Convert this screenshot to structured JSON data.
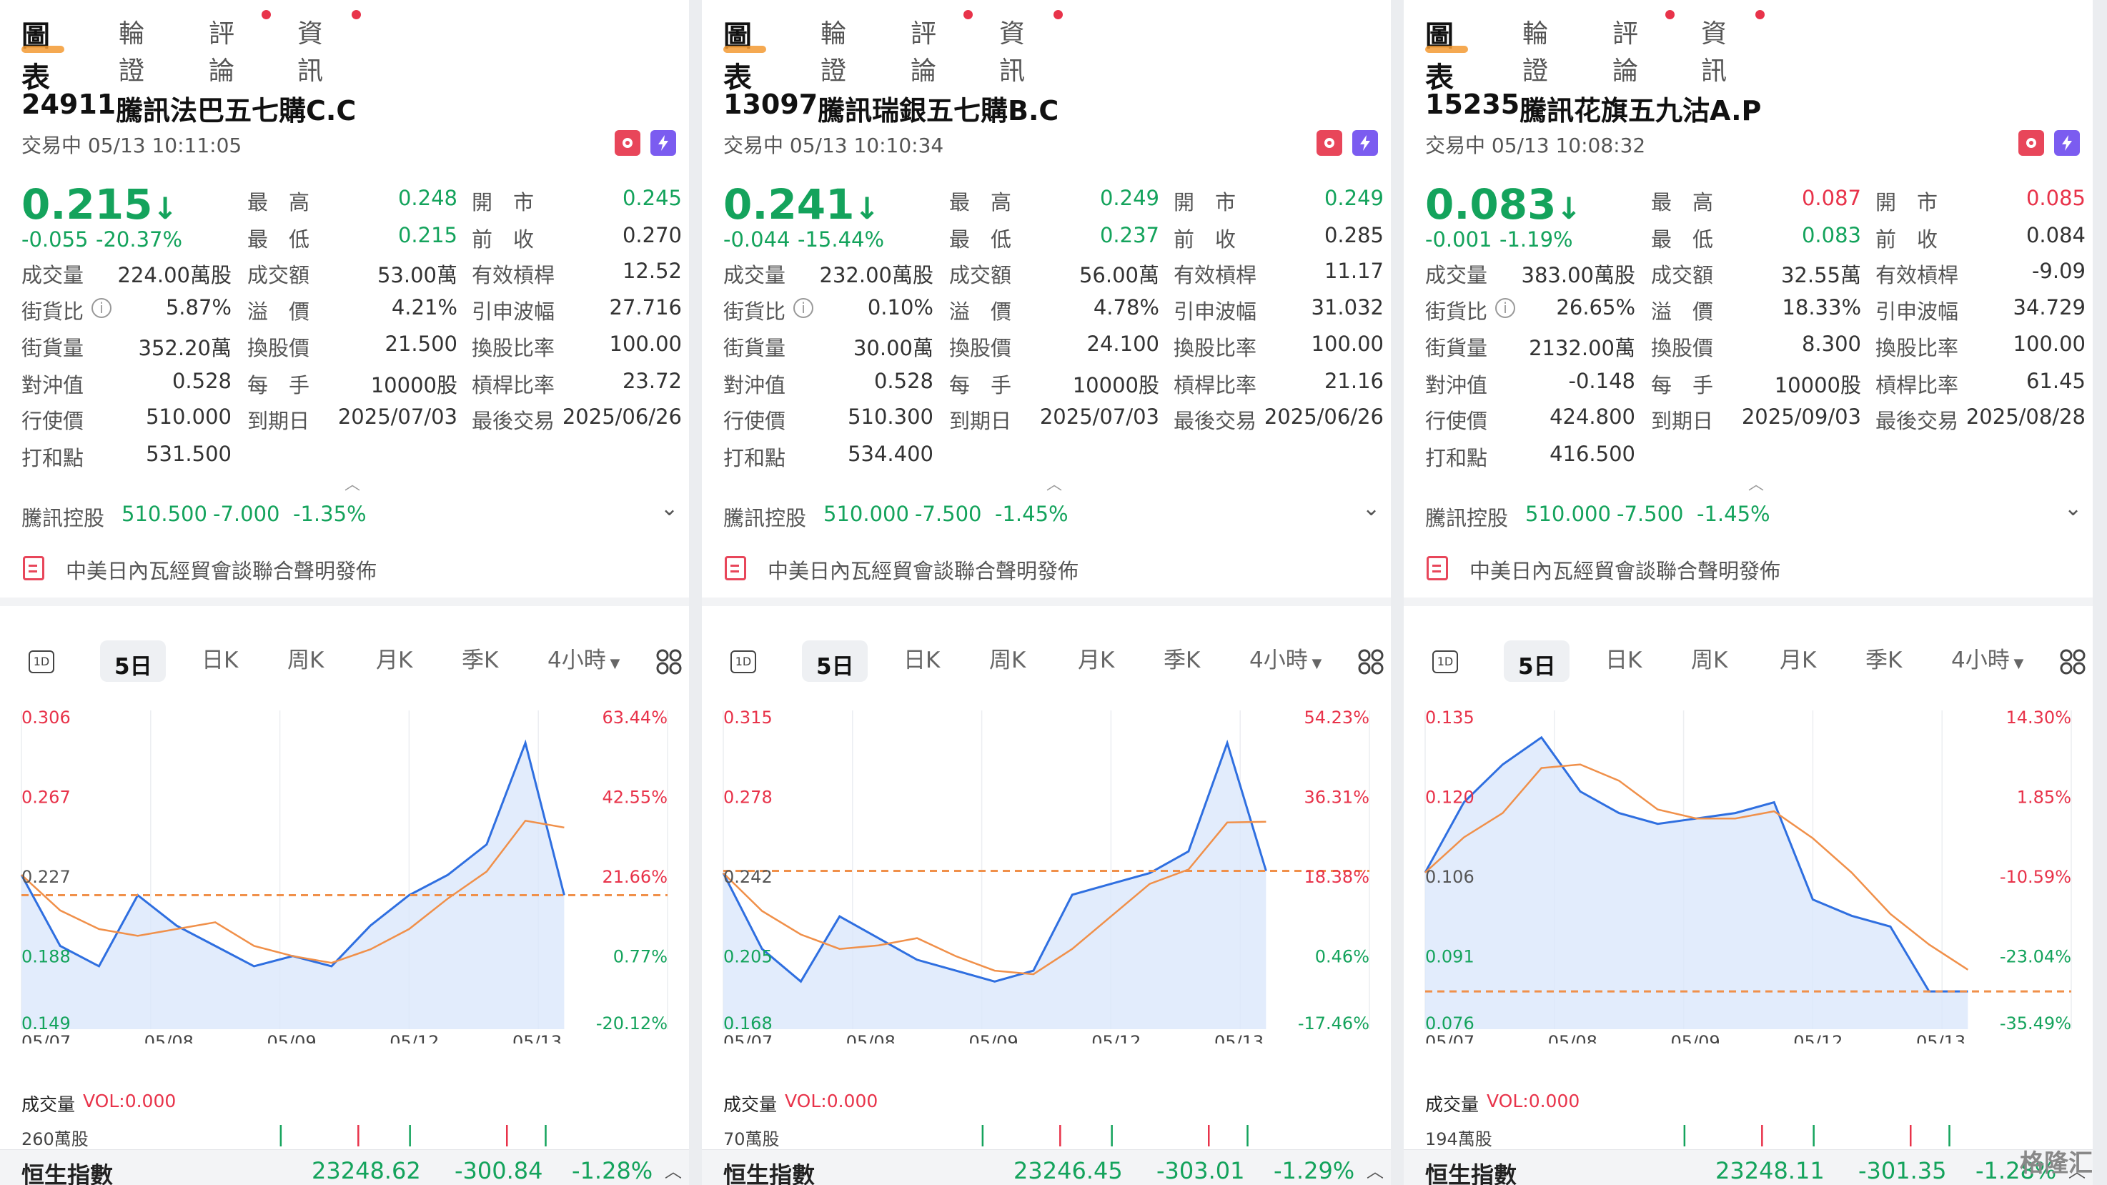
{
  "nav": {
    "chart": "圖表",
    "warrant": "輪證",
    "comment": "評論",
    "news": "資訊"
  },
  "labels": {
    "high": "最　高",
    "low": "最　低",
    "open": "開　市",
    "prev": "前　收",
    "volume": "成交量",
    "turnover": "成交額",
    "eff_gear": "有效槓桿",
    "street_ratio": "街貨比",
    "premium": "溢　價",
    "impl_vol": "引申波幅",
    "street_qty": "街貨量",
    "conv_price": "換股價",
    "conv_ratio": "換股比率",
    "delta": "對沖值",
    "lot": "每　手",
    "gear": "槓桿比率",
    "strike": "行使價",
    "expiry": "到期日",
    "last_trade": "最後交易",
    "breakeven": "打和點",
    "vol_title": "成交量",
    "vol_value": "VOL:0.000"
  },
  "tabs": [
    "5日",
    "日K",
    "周K",
    "月K",
    "季K",
    "4小時"
  ],
  "tab_1d": "1D",
  "panels": [
    {
      "code": "24911",
      "name": "騰訊法巴五七購C.C",
      "status": "交易中 05/13 10:11:05",
      "price": "0.215",
      "arrow": "↓",
      "change": "-0.055",
      "change_pct": "-20.37%",
      "high": "0.248",
      "low": "0.215",
      "open": "0.245",
      "prev": "0.270",
      "volume": "224.00萬股",
      "turnover": "53.00萬",
      "eff_gear": "12.52",
      "street_ratio": "5.87%",
      "premium": "4.21%",
      "impl_vol": "27.716",
      "street_qty": "352.20萬",
      "conv_price": "21.500",
      "conv_ratio": "100.00",
      "delta": "0.528",
      "lot": "10000股",
      "gear": "23.72",
      "strike": "510.000",
      "expiry": "2025/07/03",
      "last_trade": "2025/06/26",
      "breakeven": "531.500",
      "underlying": {
        "name": "騰訊控股",
        "price": "510.500",
        "chg": "-7.000",
        "pct": "-1.35%"
      },
      "news": "中美日內瓦經貿會談聯合聲明發佈",
      "y_left": [
        "0.306",
        "0.267",
        "0.227",
        "0.188",
        "0.149"
      ],
      "y_right": [
        "63.44%",
        "42.55%",
        "21.66%",
        "0.77%",
        "-20.12%"
      ],
      "dates": [
        "05/07",
        "05/08",
        "05/09",
        "05/12",
        "05/13"
      ],
      "vol_max": "260萬股",
      "index": {
        "name": "恒生指數",
        "value": "23248.62",
        "chg": "-300.84",
        "pct": "-1.28%"
      },
      "high_red": false,
      "open_red": false,
      "low_green": true,
      "chart_data": {
        "type": "line",
        "x": [
          "05/07",
          "05/08",
          "05/09",
          "05/12",
          "05/13"
        ],
        "ylim": [
          0.149,
          0.306
        ],
        "prev_close": 0.215,
        "series": [
          {
            "values": [
              0.225,
              0.19,
              0.18,
              0.215,
              0.2,
              0.19,
              0.18,
              0.185,
              0.18,
              0.2,
              0.215,
              0.225,
              0.24,
              0.29,
              0.215
            ]
          }
        ]
      }
    },
    {
      "code": "13097",
      "name": "騰訊瑞銀五七購B.C",
      "status": "交易中 05/13 10:10:34",
      "price": "0.241",
      "arrow": "↓",
      "change": "-0.044",
      "change_pct": "-15.44%",
      "high": "0.249",
      "low": "0.237",
      "open": "0.249",
      "prev": "0.285",
      "volume": "232.00萬股",
      "turnover": "56.00萬",
      "eff_gear": "11.17",
      "street_ratio": "0.10%",
      "premium": "4.78%",
      "impl_vol": "31.032",
      "street_qty": "30.00萬",
      "conv_price": "24.100",
      "conv_ratio": "100.00",
      "delta": "0.528",
      "lot": "10000股",
      "gear": "21.16",
      "strike": "510.300",
      "expiry": "2025/07/03",
      "last_trade": "2025/06/26",
      "breakeven": "534.400",
      "underlying": {
        "name": "騰訊控股",
        "price": "510.000",
        "chg": "-7.500",
        "pct": "-1.45%"
      },
      "news": "中美日內瓦經貿會談聯合聲明發佈",
      "y_left": [
        "0.315",
        "0.278",
        "0.242",
        "0.205",
        "0.168"
      ],
      "y_right": [
        "54.23%",
        "36.31%",
        "18.38%",
        "0.46%",
        "-17.46%"
      ],
      "dates": [
        "05/07",
        "05/08",
        "05/09",
        "05/12",
        "05/13"
      ],
      "vol_max": "70萬股",
      "index": {
        "name": "恒生指數",
        "value": "23246.45",
        "chg": "-303.01",
        "pct": "-1.29%"
      },
      "high_red": false,
      "open_red": false,
      "low_green": true,
      "chart_data": {
        "type": "line",
        "x": [
          "05/07",
          "05/08",
          "05/09",
          "05/12",
          "05/13"
        ],
        "ylim": [
          0.168,
          0.315
        ],
        "prev_close": 0.241,
        "series": [
          {
            "values": [
              0.24,
              0.205,
              0.19,
              0.22,
              0.21,
              0.2,
              0.195,
              0.19,
              0.195,
              0.23,
              0.235,
              0.24,
              0.25,
              0.3,
              0.241
            ]
          }
        ]
      }
    },
    {
      "code": "15235",
      "name": "騰訊花旗五九沽A.P",
      "status": "交易中 05/13 10:08:32",
      "price": "0.083",
      "arrow": "↓",
      "change": "-0.001",
      "change_pct": "-1.19%",
      "high": "0.087",
      "low": "0.083",
      "open": "0.085",
      "prev": "0.084",
      "volume": "383.00萬股",
      "turnover": "32.55萬",
      "eff_gear": "-9.09",
      "street_ratio": "26.65%",
      "premium": "18.33%",
      "impl_vol": "34.729",
      "street_qty": "2132.00萬",
      "conv_price": "8.300",
      "conv_ratio": "100.00",
      "delta": "-0.148",
      "lot": "10000股",
      "gear": "61.45",
      "strike": "424.800",
      "expiry": "2025/09/03",
      "last_trade": "2025/08/28",
      "breakeven": "416.500",
      "underlying": {
        "name": "騰訊控股",
        "price": "510.000",
        "chg": "-7.500",
        "pct": "-1.45%"
      },
      "news": "中美日內瓦經貿會談聯合聲明發佈",
      "y_left": [
        "0.135",
        "0.120",
        "0.106",
        "0.091",
        "0.076"
      ],
      "y_right": [
        "14.30%",
        "1.85%",
        "-10.59%",
        "-23.04%",
        "-35.49%"
      ],
      "dates": [
        "05/07",
        "05/08",
        "05/09",
        "05/12",
        "05/13"
      ],
      "vol_max": "194萬股",
      "index": {
        "name": "恒生指數",
        "value": "23248.11",
        "chg": "-301.35",
        "pct": "-1.28%"
      },
      "high_red": true,
      "open_red": true,
      "low_green": true,
      "chart_data": {
        "type": "line",
        "x": [
          "05/07",
          "05/08",
          "05/09",
          "05/12",
          "05/13"
        ],
        "ylim": [
          0.076,
          0.135
        ],
        "prev_close": 0.083,
        "series": [
          {
            "values": [
              0.105,
              0.118,
              0.125,
              0.13,
              0.12,
              0.116,
              0.114,
              0.115,
              0.116,
              0.118,
              0.1,
              0.097,
              0.095,
              0.083,
              0.083
            ]
          }
        ]
      }
    }
  ],
  "watermark": "格隆汇",
  "colors": {
    "green": "#14a35c",
    "red": "#e8334a",
    "line": "#2f6fe0",
    "avg": "#f0904a"
  }
}
